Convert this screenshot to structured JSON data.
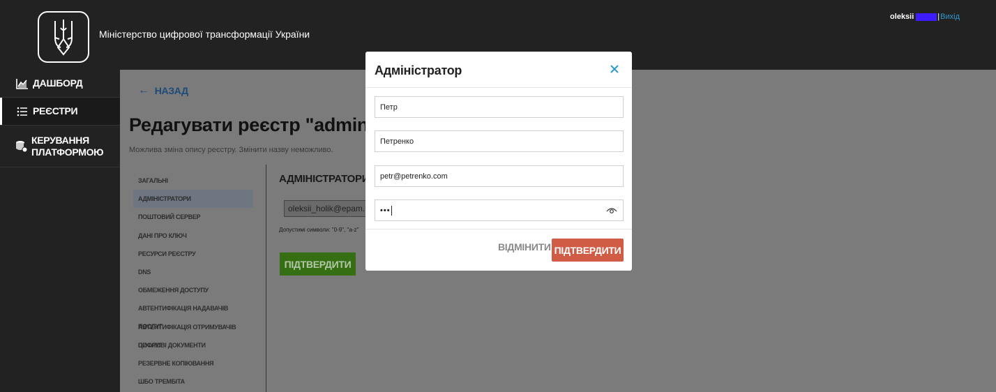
{
  "header": {
    "ministry": "Міністерство цифрової трансформації України",
    "user": "oleksii",
    "separator": "|",
    "logout": "Вихід"
  },
  "sidebar": {
    "items": [
      {
        "label": "ДАШБОРД",
        "icon": "chart-icon"
      },
      {
        "label": "РЕЄСТРИ",
        "icon": "list-icon",
        "active": true
      },
      {
        "label": "КЕРУВАННЯ ПЛАТФОРМОЮ",
        "icon": "database-gear-icon"
      }
    ]
  },
  "main": {
    "back": "НАЗАД",
    "title": "Редагувати реєстр \"admin-test\"",
    "subtitle": "Можлива зміна опису реєстру. Змінити назву неможливо.",
    "sections": [
      "ЗАГАЛЬНІ",
      "АДМІНІСТРАТОРИ",
      "ПОШТОВИЙ СЕРВЕР",
      "ДАНІ ПРО КЛЮЧ",
      "РЕСУРСИ РЕЄСТРУ",
      "DNS",
      "ОБМЕЖЕННЯ ДОСТУПУ",
      "АВТЕНТИФІКАЦІЯ НАДАВАЧІВ ПОСЛУГ",
      "АВТЕНТИФІКАЦІЯ ОТРИМУВАЧІВ ПОСЛУГ",
      "ЦИФРОВІ ДОКУМЕНТИ",
      "РЕЗЕРВНЕ КОПІЮВАННЯ",
      "ШБО ТРЕМБІТА"
    ],
    "active_section": "АДМІНІСТРАТОРИ",
    "section_title": "АДМІНІСТРАТОРИ",
    "admin_chip": "oleksii_holik@epam.c",
    "hint": "Допустимі символи: \"0-9\", \"a-z\"",
    "confirm": "ПІДТВЕРДИТИ"
  },
  "modal": {
    "title": "Адміністратор",
    "first_name": "Петр",
    "last_name": "Петренко",
    "email": "petr@petrenko.com",
    "password_mask": "•••",
    "cancel": "ВІДМІНИТИ",
    "confirm": "ПІДТВЕРДИТИ"
  },
  "colors": {
    "accent_blue": "#2b9ad3",
    "confirm_red": "#d15c45",
    "confirm_green": "#366e13"
  }
}
